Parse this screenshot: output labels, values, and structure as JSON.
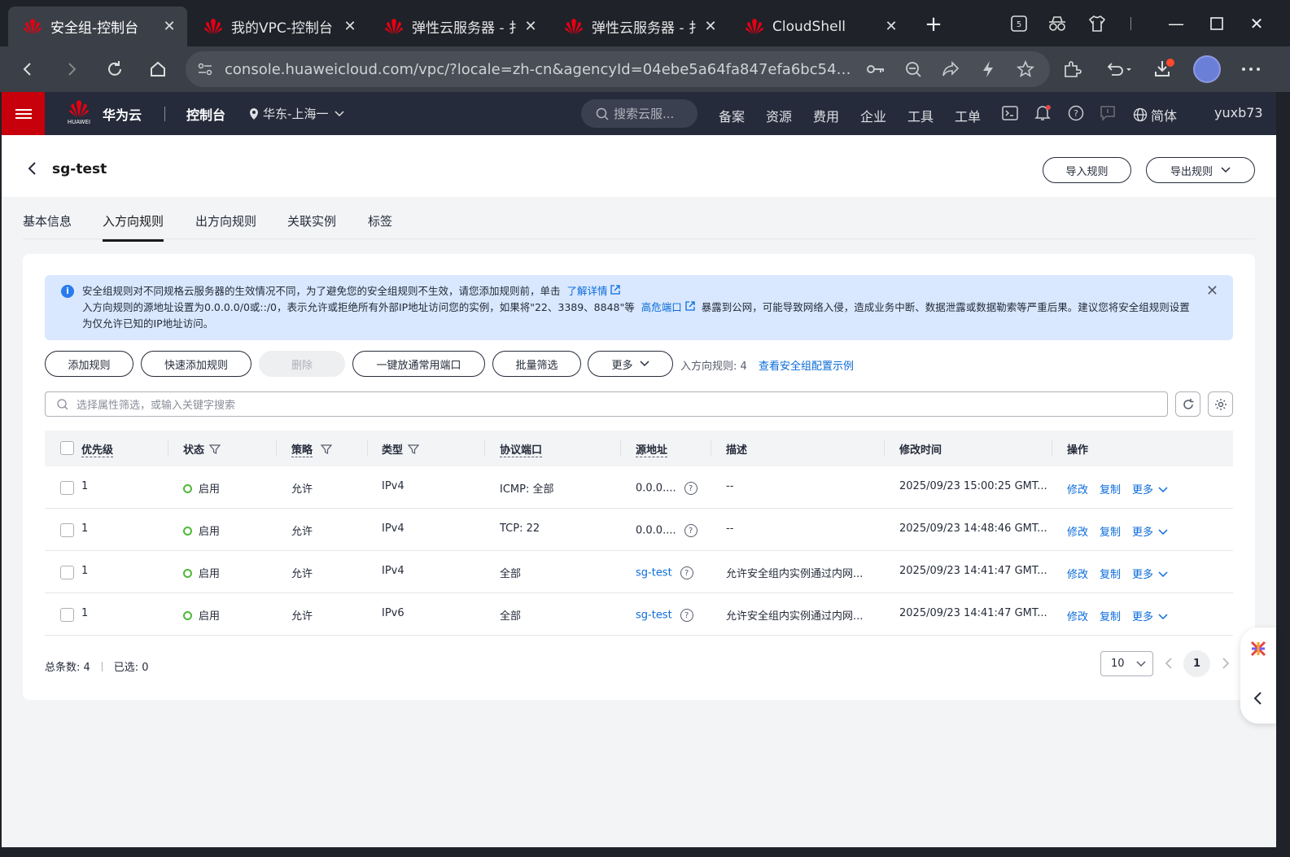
{
  "browser": {
    "tabs": [
      {
        "title": "安全组-控制台",
        "active": true
      },
      {
        "title": "我的VPC-控制台",
        "active": false
      },
      {
        "title": "弹性云服务器 - 扌",
        "active": false
      },
      {
        "title": "弹性云服务器 - 扌",
        "active": false
      },
      {
        "title": "CloudShell",
        "active": false
      }
    ],
    "url": "console.huaweicloud.com/vpc/?locale=zh-cn&agencyId=04ebe5a64fa847efa6bc54f919...",
    "workspace_badge": "5"
  },
  "topnav": {
    "logo_word": "HUAWEI",
    "brand": "华为云",
    "console": "控制台",
    "region": "华东-上海一",
    "search_placeholder": "搜索云服...",
    "links": [
      "备案",
      "资源",
      "费用",
      "企业",
      "工具",
      "工单"
    ],
    "language": "简体",
    "user": "yuxb73"
  },
  "page": {
    "title": "sg-test",
    "import_btn": "导入规则",
    "export_btn": "导出规则",
    "tabs": [
      "基本信息",
      "入方向规则",
      "出方向规则",
      "关联实例",
      "标签"
    ],
    "active_tab": "入方向规则"
  },
  "alert": {
    "line1": "安全组规则对不同规格云服务器的生效情况不同，为了避免您的安全组规则不生效，请您添加规则前，单击",
    "line1_link": "了解详情",
    "line2a": "入方向规则的源地址设置为0.0.0.0/0或::/0，表示允许或拒绝所有外部IP地址访问您的实例，如果将\"22、3389、8848\"等",
    "line2_link": "高危端口",
    "line2b": "暴露到公网，可能导致网络入侵，造成业务中断、数据泄露或数据勒索等严重后果。建议您将安全组规则设置为仅允许已知的IP地址访问。"
  },
  "toolbar": {
    "add_rule": "添加规则",
    "quick_add": "快速添加规则",
    "delete": "删除",
    "open_common_ports": "一键放通常用端口",
    "batch_filter": "批量筛选",
    "more": "更多",
    "rule_count": "入方向规则: 4",
    "example_link": "查看安全组配置示例"
  },
  "search": {
    "placeholder": "选择属性筛选，或输入关键字搜索"
  },
  "table": {
    "headers": [
      "优先级",
      "状态",
      "策略",
      "类型",
      "协议端口",
      "源地址",
      "描述",
      "修改时间",
      "操作"
    ],
    "rows": [
      {
        "priority": "1",
        "status": "启用",
        "policy": "允许",
        "type": "IPv4",
        "port": "ICMP: 全部",
        "source": "0.0.0....",
        "source_is_link": false,
        "desc": "--",
        "time": "2025/09/23 15:00:25 GMT...",
        "op_edit": "修改",
        "op_copy": "复制",
        "op_more": "更多"
      },
      {
        "priority": "1",
        "status": "启用",
        "policy": "允许",
        "type": "IPv4",
        "port": "TCP: 22",
        "source": "0.0.0....",
        "source_is_link": false,
        "desc": "--",
        "time": "2025/09/23 14:48:46 GMT...",
        "op_edit": "修改",
        "op_copy": "复制",
        "op_more": "更多"
      },
      {
        "priority": "1",
        "status": "启用",
        "policy": "允许",
        "type": "IPv4",
        "port": "全部",
        "source": "sg-test",
        "source_is_link": true,
        "desc": "允许安全组内实例通过内网...",
        "time": "2025/09/23 14:41:47 GMT...",
        "op_edit": "修改",
        "op_copy": "复制",
        "op_more": "更多"
      },
      {
        "priority": "1",
        "status": "启用",
        "policy": "允许",
        "type": "IPv6",
        "port": "全部",
        "source": "sg-test",
        "source_is_link": true,
        "desc": "允许安全组内实例通过内网...",
        "time": "2025/09/23 14:41:47 GMT...",
        "op_edit": "修改",
        "op_copy": "复制",
        "op_more": "更多"
      }
    ]
  },
  "footer": {
    "total": "总条数: 4",
    "selected": "已选: 0",
    "page_size": "10",
    "current_page": "1"
  },
  "colors": {
    "brand_red": "#c7000b",
    "link_blue": "#0b6bd9",
    "status_green": "#50b83c",
    "nav_bg": "#252b3a"
  }
}
